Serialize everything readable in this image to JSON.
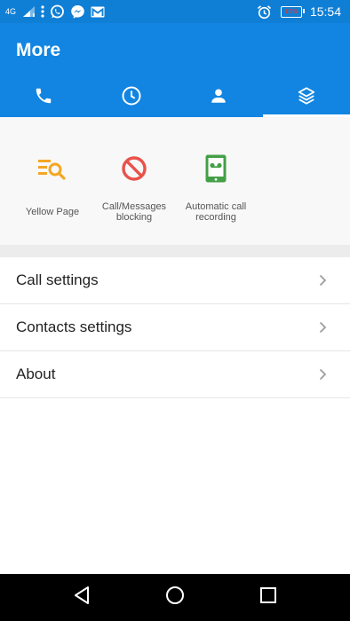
{
  "status_bar": {
    "network_label": "4G",
    "time": "15:54",
    "battery_percent_label": "15%",
    "icons": [
      "signal-icon",
      "more-vert-icon",
      "whatsapp-icon",
      "messenger-icon",
      "gmail-icon",
      "alarm-icon",
      "battery-icon"
    ]
  },
  "app_bar": {
    "title": "More",
    "tabs": [
      {
        "icon": "phone-icon",
        "active": false
      },
      {
        "icon": "clock-icon",
        "active": false
      },
      {
        "icon": "person-icon",
        "active": false
      },
      {
        "icon": "layers-icon",
        "active": true
      }
    ]
  },
  "shortcuts": [
    {
      "label": "Yellow Page",
      "icon": "yellow-page-icon",
      "color": "#f5a623"
    },
    {
      "label": "Call/Messages\nblocking",
      "icon": "block-icon",
      "color": "#e8524a"
    },
    {
      "label": "Automatic call\nrecording",
      "icon": "voicemail-icon",
      "color": "#43a047"
    }
  ],
  "settings": [
    {
      "label": "Call settings"
    },
    {
      "label": "Contacts settings"
    },
    {
      "label": "About"
    }
  ],
  "nav_bar": {
    "buttons": [
      "back-icon",
      "home-icon",
      "recents-icon"
    ]
  },
  "colors": {
    "status_bar": "#0f7fd6",
    "app_bar": "#1185e1",
    "accent_white": "#ffffff"
  }
}
